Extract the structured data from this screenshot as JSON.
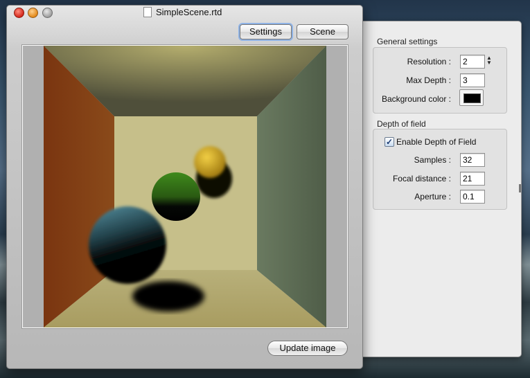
{
  "window": {
    "title": "SimpleScene.rtd",
    "tabs": {
      "settings_label": "Settings",
      "scene_label": "Scene"
    },
    "update_button_label": "Update image"
  },
  "general_settings": {
    "title": "General settings",
    "resolution_label": "Resolution :",
    "resolution_value": "2",
    "max_depth_label": "Max Depth :",
    "max_depth_value": "3",
    "background_color_label": "Background color :",
    "background_color": "#000000"
  },
  "depth_of_field": {
    "title": "Depth of field",
    "enable_label": "Enable Depth of Field",
    "enabled": true,
    "samples_label": "Samples :",
    "samples_value": "32",
    "focal_distance_label": "Focal distance :",
    "focal_distance_value": "21",
    "aperture_label": "Aperture :",
    "aperture_value": "0.1"
  },
  "scene_colors": {
    "left_wall": "#8a3c12",
    "right_wall": "#5a6a50",
    "ceiling": "#8a8a5a",
    "floor_back": "#c8c08a",
    "sphere_yellow": "#e0b830",
    "sphere_green": "#3a7a1a",
    "sphere_teal": "#4a7f8f"
  }
}
